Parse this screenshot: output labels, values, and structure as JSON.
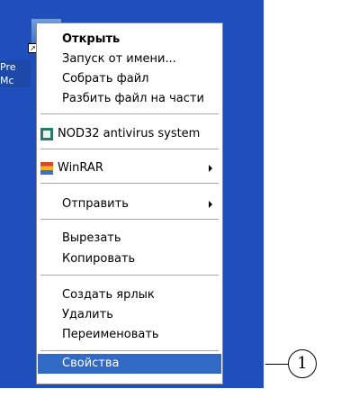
{
  "desktop": {
    "icon_label_lines": [
      "Pre",
      "Mc"
    ]
  },
  "context_menu": {
    "items": [
      {
        "label": "Открыть"
      },
      {
        "label": "Запуск от имени..."
      },
      {
        "label": "Собрать файл"
      },
      {
        "label": "Разбить файл на части"
      },
      {
        "label": "NOD32 antivirus system",
        "icon": "nod32-icon"
      },
      {
        "label": "WinRAR",
        "icon": "winrar-icon"
      },
      {
        "label": "Отправить"
      },
      {
        "label": "Вырезать"
      },
      {
        "label": "Копировать"
      },
      {
        "label": "Создать ярлык"
      },
      {
        "label": "Удалить"
      },
      {
        "label": "Переименовать"
      },
      {
        "label": "Свойства"
      }
    ]
  },
  "callout": {
    "number": "1"
  }
}
